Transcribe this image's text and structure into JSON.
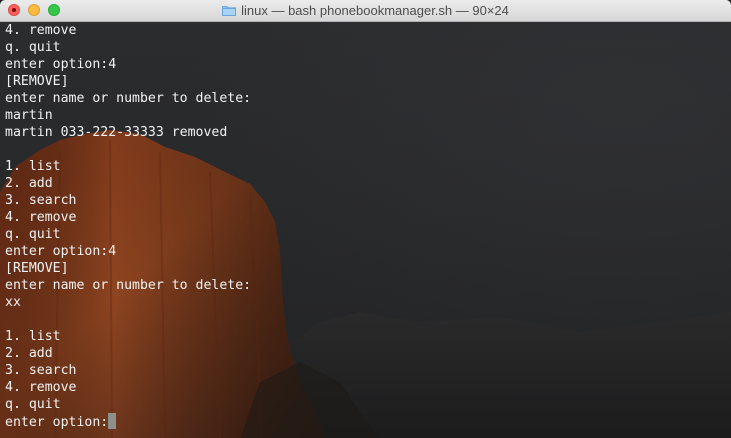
{
  "window": {
    "title": "linux — bash phonebookmanager.sh — 90×24",
    "title_icon": "folder-icon",
    "controls": [
      "close-button",
      "minimize-button",
      "zoom-button"
    ]
  },
  "terminal": {
    "lines": [
      "4. remove",
      "q. quit",
      "enter option:4",
      "[REMOVE]",
      "enter name or number to delete:",
      "martin",
      "martin 033-222-33333 removed",
      "",
      "1. list",
      "2. add",
      "3. search",
      "4. remove",
      "q. quit",
      "enter option:4",
      "[REMOVE]",
      "enter name or number to delete:",
      "xx",
      "",
      "1. list",
      "2. add",
      "3. search",
      "4. remove",
      "q. quit",
      "enter option:"
    ],
    "cursor_line": 23
  },
  "colors": {
    "text": "#f2f2f2",
    "background": "#262728",
    "cursor": "#8f8f8f",
    "cliff": "#8a3d1c"
  }
}
